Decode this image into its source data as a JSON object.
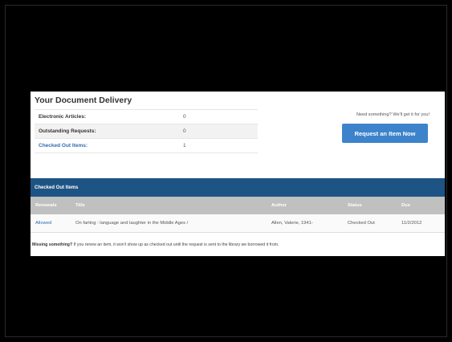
{
  "delivery": {
    "title": "Your Document Delivery",
    "summary": [
      {
        "label": "Electronic Articles:",
        "value": "0"
      },
      {
        "label": "Outstanding Requests:",
        "value": "0"
      },
      {
        "label": "Checked Out Items:",
        "value": "1"
      }
    ],
    "tagline": "Need something? We'll get it for you!",
    "request_button": "Request an Item Now"
  },
  "checked_out": {
    "heading": "Checked Out Items",
    "columns": [
      "Renewals",
      "Title",
      "Author",
      "Status",
      "Due"
    ],
    "rows": [
      {
        "renewals": "Allowed",
        "title": "On farting : language and laughter in the Middle Ages /",
        "author": "Allen, Valerie, 1941-",
        "status": "Checked Out",
        "due": "11/2/2012"
      }
    ]
  },
  "footnote": {
    "bold": "Missing something?",
    "text": " If you renew an item, it won't show up as checked out until the request is sent to the library we borrowed it from."
  }
}
